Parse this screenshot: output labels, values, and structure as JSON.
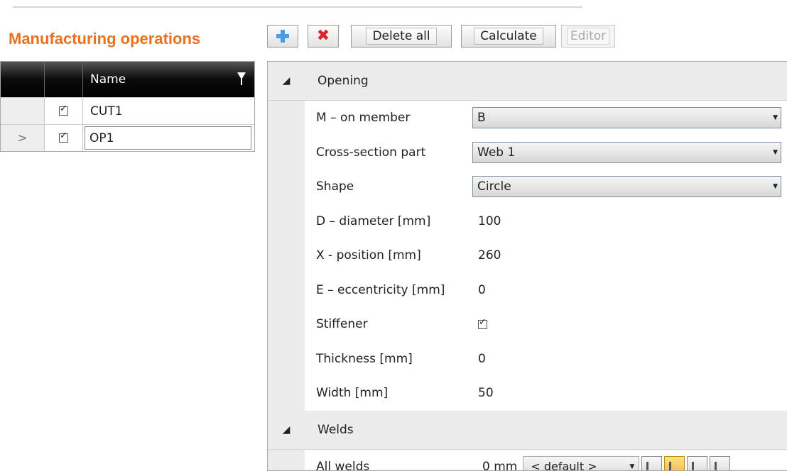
{
  "section": {
    "title": "Manufacturing operations"
  },
  "toolbar": {
    "add_icon": "plus-icon",
    "delete_icon": "red-x-icon",
    "delete_all_label": "Delete all",
    "calculate_label": "Calculate",
    "editor_label": "Editor"
  },
  "operations_table": {
    "header": {
      "name_label": "Name",
      "filter_icon": "filter-icon"
    },
    "rows": [
      {
        "name": "CUT1",
        "checked": true,
        "current": false,
        "indicator": ""
      },
      {
        "name": "OP1",
        "checked": true,
        "current": true,
        "indicator": ">"
      }
    ]
  },
  "properties": {
    "opening": {
      "title": "Opening",
      "member_label": "M – on member",
      "member_value": "B",
      "cs_part_label": "Cross-section part",
      "cs_part_value": "Web 1",
      "shape_label": "Shape",
      "shape_value": "Circle",
      "diameter_label": "D – diameter [mm]",
      "diameter_value": "100",
      "position_label": "X - position [mm]",
      "position_value": "260",
      "eccentricity_label": "E – eccentricity [mm]",
      "eccentricity_value": "0",
      "stiffener_label": "Stiffener",
      "stiffener_checked": true,
      "thickness_label": "Thickness [mm]",
      "thickness_value": "0",
      "width_label": "Width [mm]",
      "width_value": "50"
    },
    "welds": {
      "title": "Welds",
      "all_welds_label": "All welds",
      "size_value": "0 mm",
      "type_value": "< default >"
    }
  },
  "colors": {
    "title_orange": "#e8721f",
    "header_black": "#000000",
    "accent_blue": "#4b9be0",
    "delete_red": "#d8262c"
  }
}
